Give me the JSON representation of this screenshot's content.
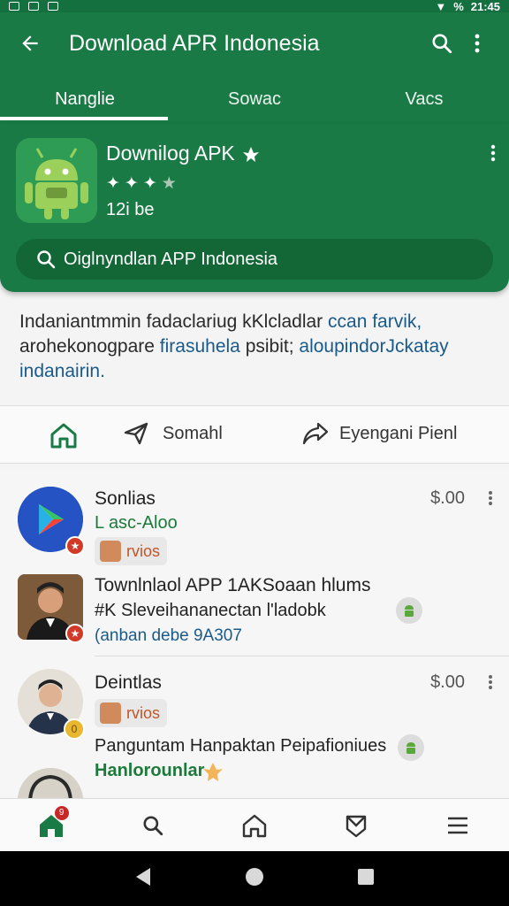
{
  "status_bar": {
    "time": "21:45",
    "percent": "%"
  },
  "header": {
    "title": "Download APR Indonesia",
    "tabs": [
      {
        "label": "Nanglie",
        "active": true
      },
      {
        "label": "Sowac",
        "active": false
      },
      {
        "label": "Vacs",
        "active": false
      }
    ]
  },
  "app_card": {
    "name": "Downilog APK",
    "rating_stars": 3,
    "rating_max": 4,
    "size": "12i be",
    "search_text": "Oiglnyndlan APP Indonesia"
  },
  "description": {
    "part1": "Indaniantmmin fadaclariug kKlcladlar ",
    "link1": "ccan farvik,",
    "part2": " arohekonogpare ",
    "link2": "firasuhela",
    "part3": " psibit; ",
    "link3": "aloupindorJckatay indanairin."
  },
  "actions": {
    "send_label": "Somahl",
    "share_label": "Eyengani Pienl"
  },
  "list": [
    {
      "title": "Sonlias",
      "subtitle": "L asc-Aloo",
      "price": "$.00",
      "tag": "rvios"
    },
    {
      "title": "Townlnlaol APP 1AKSoaan hlums",
      "line2": "#K Sleveihananectan l'ladobk",
      "line3": "(anban debe 9A307"
    },
    {
      "title": "Deintlas",
      "price": "$.00",
      "tag": "rvios",
      "badge": "0"
    },
    {
      "title": "Panguntam Hanpaktan Peipafioniues",
      "subtitle": "Hanlorounlar"
    }
  ],
  "bottom_nav": {
    "notification_count": "9"
  },
  "colors": {
    "primary": "#1a7a45",
    "primary_dark": "#136737",
    "link": "#1a5a8a",
    "green_text": "#1d7a3a"
  }
}
